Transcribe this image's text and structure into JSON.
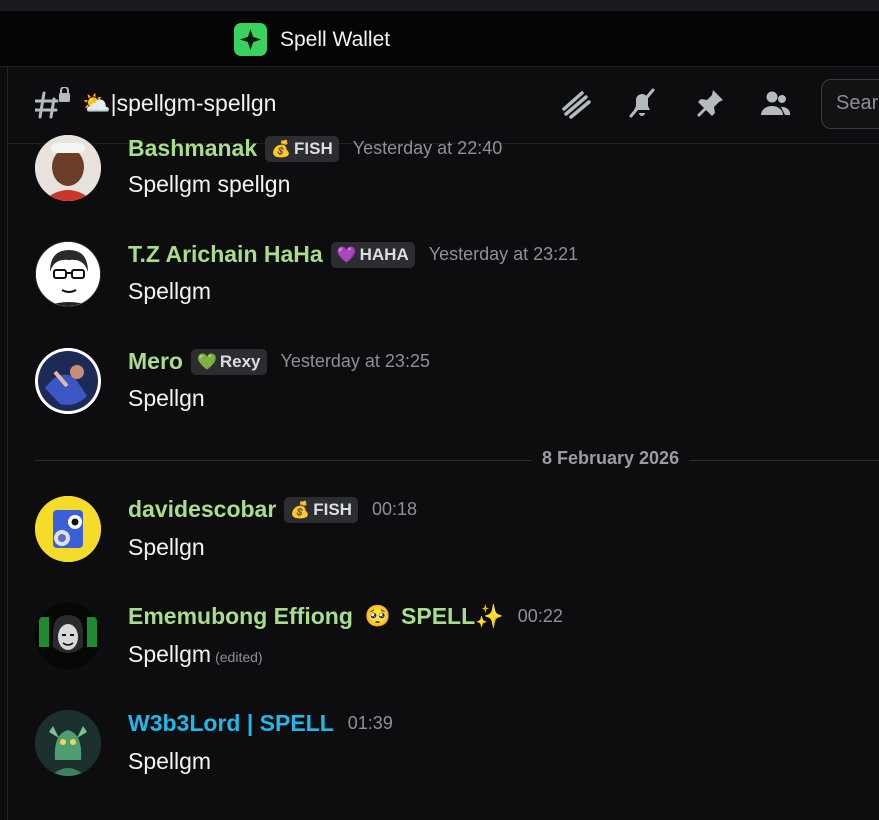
{
  "app": {
    "name": "Spell Wallet",
    "logo_icon": "sparkle-icon",
    "accent": "#3ad25f"
  },
  "channel": {
    "emoji": "⛅",
    "name": "|spellgm-spellgn"
  },
  "toolbar": {
    "icons": [
      "threads-icon",
      "notifications-muted-icon",
      "pin-icon",
      "members-icon"
    ],
    "search_placeholder": "Search"
  },
  "divider": {
    "label": "8 February 2026"
  },
  "messages": [
    {
      "author": "Bashmanak",
      "badge_icon": "💰",
      "badge": "FISH",
      "time": "Yesterday at 22:40",
      "text": "Spellgm spellgn"
    },
    {
      "author": "T.Z Arichain HaHa",
      "badge_icon": "💜",
      "badge": "HAHA",
      "time": "Yesterday at 23:21",
      "text": "Spellgm"
    },
    {
      "author": "Mero",
      "badge_icon": "💚",
      "badge": "Rexy",
      "time": "Yesterday at 23:25",
      "text": "Spellgn"
    },
    {
      "author": "davidescobar",
      "badge_icon": "💰",
      "badge": "FISH",
      "time": "00:18",
      "text": "Spellgn"
    },
    {
      "author": "Ememubong Effiong",
      "emoji": "🥺",
      "tag": "SPELL✨",
      "time": "00:22",
      "text": "Spellgm",
      "edited": "(edited)"
    },
    {
      "author": "W3b3Lord | SPELL",
      "time": "01:39",
      "text": "Spellgm",
      "author_color": "#21b7e8"
    }
  ]
}
